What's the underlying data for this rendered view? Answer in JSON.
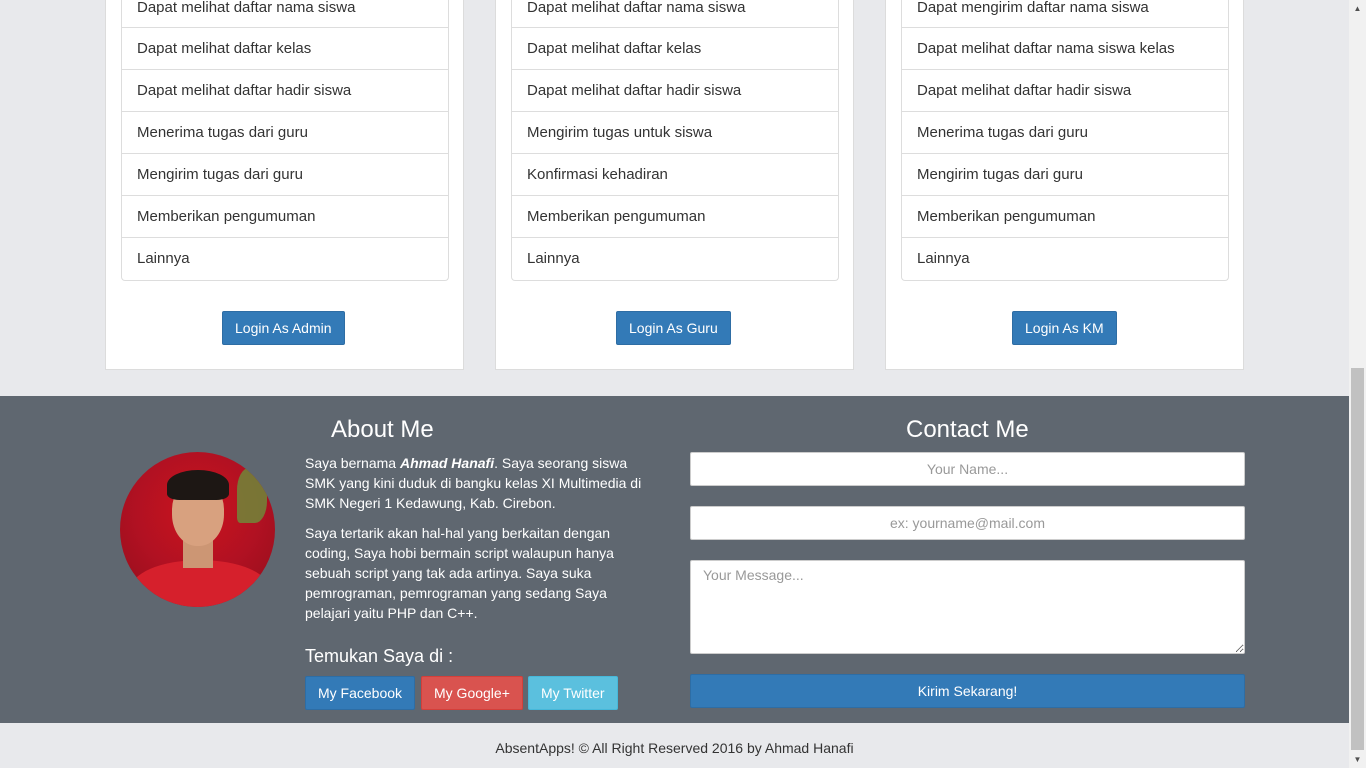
{
  "cards": [
    {
      "items": [
        "Dapat melihat daftar nama siswa",
        "Dapat melihat daftar kelas",
        "Dapat melihat daftar hadir siswa",
        "Menerima tugas dari guru",
        "Mengirim tugas dari guru",
        "Memberikan pengumuman",
        "Lainnya"
      ],
      "button": "Login As Admin"
    },
    {
      "items": [
        "Dapat melihat daftar nama siswa",
        "Dapat melihat daftar kelas",
        "Dapat melihat daftar hadir siswa",
        "Mengirim tugas untuk siswa",
        "Konfirmasi kehadiran",
        "Memberikan pengumuman",
        "Lainnya"
      ],
      "button": "Login As Guru"
    },
    {
      "items": [
        "Dapat mengirim daftar nama siswa",
        "Dapat melihat daftar nama siswa kelas",
        "Dapat melihat daftar hadir siswa",
        "Menerima tugas dari guru",
        "Mengirim tugas dari guru",
        "Memberikan pengumuman",
        "Lainnya"
      ],
      "button": "Login As KM"
    }
  ],
  "about": {
    "title": "About Me",
    "p1_before": "Saya bernama ",
    "p1_name": "Ahmad Hanafi",
    "p1_after": ". Saya seorang siswa SMK yang kini duduk di bangku kelas XI Multimedia di SMK Negeri 1 Kedawung, Kab. Cirebon.",
    "p2": "Saya tertarik akan hal-hal yang berkaitan dengan coding, Saya hobi bermain script walaupun hanya sebuah script yang tak ada artinya. Saya suka pemrograman, pemrograman yang sedang Saya pelajari yaitu PHP dan C++.",
    "find_title": "Temukan Saya di :",
    "facebook": "My Facebook",
    "google": "My Google+",
    "twitter": "My Twitter"
  },
  "contact": {
    "title": "Contact Me",
    "name_placeholder": "Your Name...",
    "email_placeholder": "ex: yourname@mail.com",
    "message_placeholder": "Your Message...",
    "send": "Kirim Sekarang!"
  },
  "footer": {
    "copyright": "AbsentApps! © All Right Reserved 2016 by Ahmad Hanafi"
  },
  "colors": {
    "primary": "#337ab7",
    "danger": "#d9534f",
    "info": "#5bc0de",
    "footer_bg": "#5f6770",
    "page_bg": "#e8e9ec"
  }
}
